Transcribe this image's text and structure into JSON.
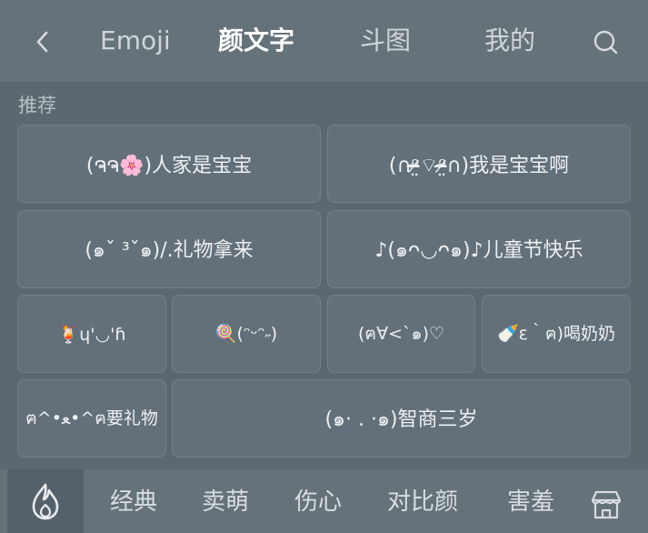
{
  "nav": {
    "tabs": [
      "Emoji",
      "颜文字",
      "斗图",
      "我的"
    ],
    "active_tab": "颜文字"
  },
  "section": {
    "label": "推荐"
  },
  "items": [
    "(ຈຈ🌸)人家是宝宝",
    "(∩ᵒ̴̶̷̤⌔ᵒ̴̶̷̤∩)我是宝宝啊",
    "(๑ˇ ³ˇ๑)/.礼物拿来",
    "♪(๑ᴖ◡ᴖ๑)♪儿童节快乐",
    "🍹ɥ'◡'ɦ",
    "🍭(ᵔᵕᵔ˶)",
    "(ฅ∀<`๑)♡",
    "🍼ε｀ฅ)喝奶奶",
    "ฅ^•ﻌ•^ฅ要礼物",
    "(๑· . ·๑)智商三岁"
  ],
  "categories": [
    "经典",
    "卖萌",
    "伤心",
    "对比颜",
    "害羞"
  ],
  "icons": {
    "back": "chevron-left-icon",
    "search": "search-icon",
    "hot": "flame-icon",
    "shop": "shop-icon"
  },
  "colors": {
    "background": "#5c6870",
    "bar": "#65727a",
    "cell": "#63707a",
    "text": "#eef1f2"
  }
}
